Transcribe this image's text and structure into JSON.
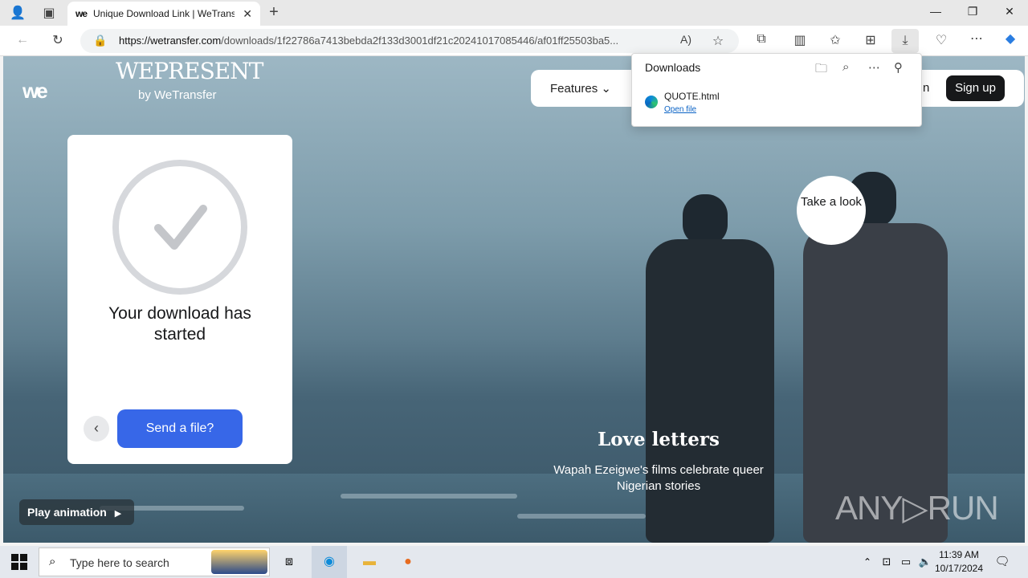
{
  "browser": {
    "tab_title": "Unique Download Link | WeTrans",
    "tab_favicon": "we",
    "url_domain": "https://wetransfer.com",
    "url_path": "/downloads/1f22786a7413bebda2f133d3001df21c20241017085446/af01ff25503ba5...",
    "window_controls": [
      "—",
      "❐",
      "✕"
    ]
  },
  "downloads": {
    "title": "Downloads",
    "file_name": "QUOTE.html",
    "open_label": "Open file"
  },
  "site": {
    "logo": "we",
    "wepresent": "WEPRESENT",
    "by": "by WeTransfer",
    "nav_features": "Features",
    "nav_login_fragment": "n",
    "signup": "Sign up"
  },
  "card": {
    "message": "Your download has started",
    "send_button": "Send a file?"
  },
  "hero": {
    "take_look": "Take a look",
    "story_title": "Love letters",
    "story_subtitle": "Wapah Ezeigwe's films celebrate queer Nigerian stories",
    "play_animation": "Play animation",
    "watermark": "ANY▷RUN"
  },
  "taskbar": {
    "search_placeholder": "Type here to search",
    "time": "11:39 AM",
    "date": "10/17/2024"
  }
}
